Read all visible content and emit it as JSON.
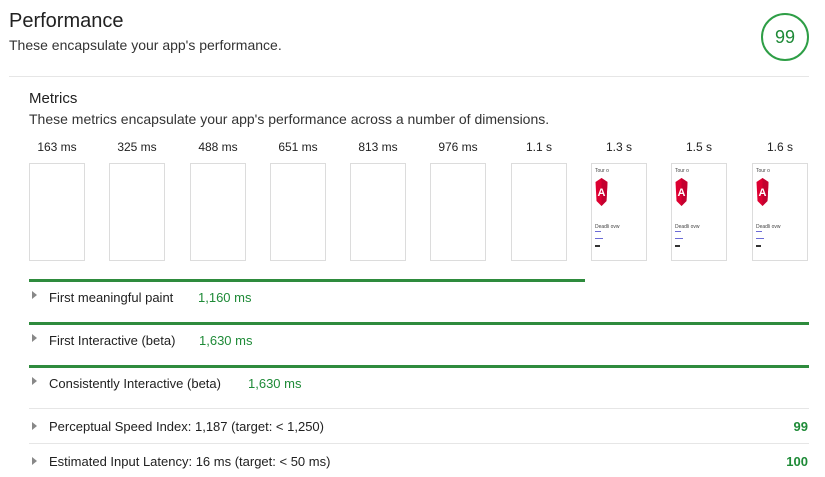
{
  "header": {
    "title": "Performance",
    "description": "These encapsulate your app's performance.",
    "score": "99"
  },
  "metrics": {
    "title": "Metrics",
    "description": "These metrics encapsulate your app's performance across a number of dimensions."
  },
  "filmstrip": {
    "timestamps": [
      "163 ms",
      "325 ms",
      "488 ms",
      "651 ms",
      "813 ms",
      "976 ms",
      "1.1 s",
      "1.3 s",
      "1.5 s",
      "1.6 s"
    ],
    "thumb_header": "Tour o",
    "thumb_text": "Deadli ovw",
    "accent_color": "#dd0031"
  },
  "audits": [
    {
      "label": "First meaningful paint",
      "value": "1,160 ms",
      "bar_fraction": 0.71
    },
    {
      "label": "First Interactive (beta)",
      "value": "1,630 ms",
      "bar_fraction": 1.0
    },
    {
      "label": "Consistently Interactive (beta)",
      "value": "1,630 ms",
      "bar_fraction": 1.0
    },
    {
      "label": "Perceptual Speed Index: 1,187 (target: < 1,250)",
      "score": "99"
    },
    {
      "label": "Estimated Input Latency: 16 ms (target: < 50 ms)",
      "score": "100"
    }
  ],
  "colors": {
    "pass_green": "#1e8a37",
    "bar_green": "#2e8b3d"
  }
}
